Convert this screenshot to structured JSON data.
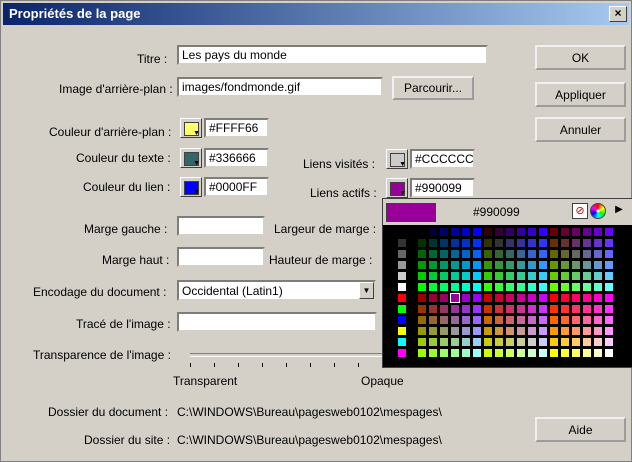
{
  "window": {
    "title": "Propriétés de la page",
    "close_glyph": "×"
  },
  "buttons": {
    "ok": "OK",
    "apply": "Appliquer",
    "cancel": "Annuler",
    "browse": "Parcourir...",
    "help": "Aide"
  },
  "labels": {
    "titre": "Titre :",
    "image_bg": "Image d'arrière-plan :",
    "bg_color": "Couleur d'arrière-plan :",
    "text_color": "Couleur du texte :",
    "link_color": "Couleur du lien :",
    "visited": "Liens visités :",
    "active": "Liens actifs :",
    "margin_left": "Marge gauche :",
    "margin_width": "Largeur de marge :",
    "margin_top": "Marge haut :",
    "margin_height": "Hauteur de marge :",
    "encoding": "Encodage du document :",
    "trace": "Tracé de l'image :",
    "transparency": "Transparence de l'image :",
    "transparent": "Transparent",
    "opaque": "Opaque",
    "doc_folder": "Dossier du document :",
    "site_folder": "Dossier du site :"
  },
  "values": {
    "title": "Les pays du monde",
    "image_bg": "images/fondmonde.gif",
    "bg_color": "#FFFF66",
    "text_color": "#336666",
    "link_color": "#0000FF",
    "visited": "#CCCCCC",
    "active": "#990099",
    "margin_left": "",
    "margin_top": "",
    "encoding": "Occidental (Latin1)",
    "trace": "",
    "doc_folder": "C:\\WINDOWS\\Bureau\\pagesweb0102\\mespages\\",
    "site_folder": "C:\\WINDOWS\\Bureau\\pagesweb0102\\mespages\\"
  },
  "colors": {
    "bg_swatch": "#FFFF66",
    "text_swatch": "#336666",
    "link_swatch": "#0000FF",
    "visited_swatch": "#CCCCCC",
    "active_swatch": "#990099"
  },
  "picker": {
    "hex": "#990099",
    "preview_color": "#990099",
    "icons": [
      "no-color-icon",
      "color-wheel-icon",
      "menu-arrow-icon"
    ]
  }
}
